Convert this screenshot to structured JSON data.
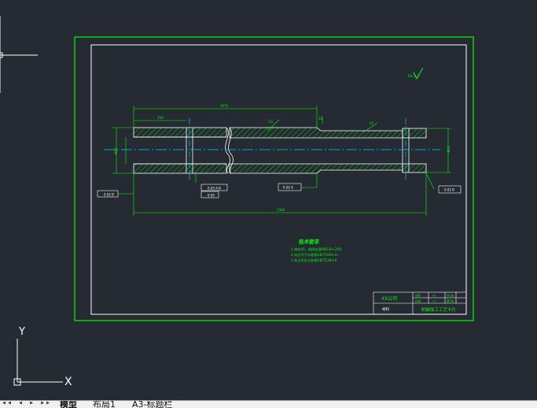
{
  "colors": {
    "background": "#252a33",
    "frame": "#00ff00",
    "white": "#ffffff",
    "center_line": "#00ccff",
    "dimension": "#00ff00",
    "hatch": "#00ff00",
    "annotation": "#ffff00"
  },
  "drawing": {
    "tech_title": "技术要求",
    "tech_lines": [
      "1.材料45，调质处理HB220~250",
      "2.未注尺寸公差按GB/T1804-m",
      "3.未注形位公差按GB/T1184-K"
    ],
    "title_block": {
      "company": "XX公司",
      "part_name": "机械加工工艺卡片",
      "material_label": "材料",
      "material": "45",
      "scale_label": "比例",
      "scale": "1:1",
      "sheet_label": "共1张",
      "sheet_no": "第1张"
    },
    "dims": {
      "top_overall": "1075",
      "left_seg": "250",
      "bottom_overall": "1340",
      "diameter_left": "Φ80",
      "diameter_right": "Φ60",
      "chamfer_a": "C1",
      "chamfer_b": "C2",
      "keyway": "12",
      "roughness": "Ra 3.2"
    },
    "gdt": {
      "left": "0.02  B",
      "mid_a": "0.03  A-B",
      "mid_b": "0.05",
      "center": "0.02  A",
      "right": "0.02  B"
    }
  },
  "tabs": {
    "nav": "◂◂ ◂ ▸ ▸▸",
    "model": "模型",
    "layout1": "布局1",
    "a3": "A3-标题栏"
  },
  "ucs": {
    "x_label": "X",
    "y_label": "Y"
  }
}
